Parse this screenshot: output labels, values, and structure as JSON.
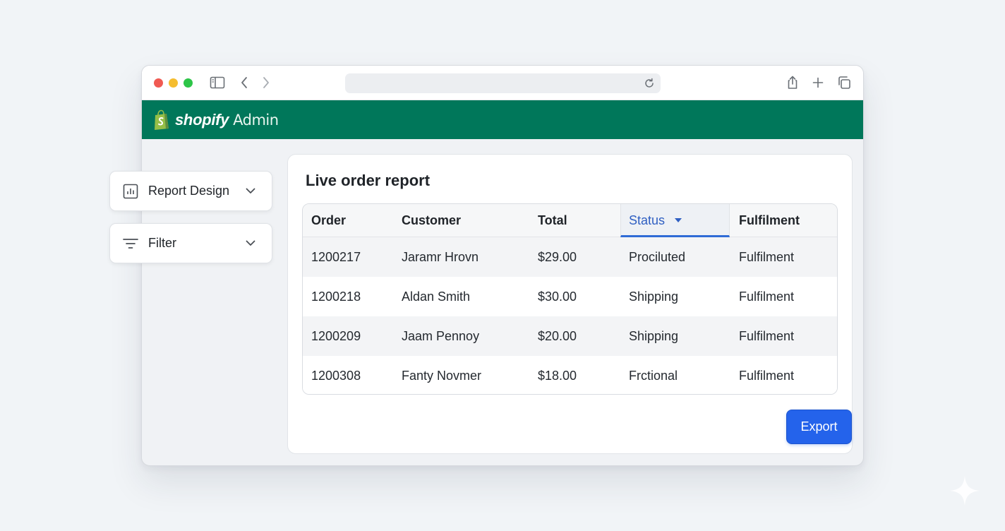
{
  "browser": {
    "url": ""
  },
  "header": {
    "brand": "shopify",
    "brand_suffix": "Admin"
  },
  "sidebar": {
    "items": [
      {
        "label": "Report Design",
        "icon": "bar-chart-icon"
      },
      {
        "label": "Filter",
        "icon": "filter-lines-icon"
      }
    ]
  },
  "report": {
    "title": "Live order report",
    "columns": [
      "Order",
      "Customer",
      "Total",
      "Status",
      "Fulfilment"
    ],
    "sorted_column": "Status",
    "rows": [
      [
        "1200217",
        "Jaramr Hrovn",
        "$29.00",
        "Prociluted",
        "Fulfilment"
      ],
      [
        "1200218",
        "Aldan Smith",
        "$30.00",
        "Shipping",
        "Fulfilment"
      ],
      [
        "1200209",
        "Jaam Pennoy",
        "$20.00",
        "Shipping",
        "Fulfilment"
      ],
      [
        "1200308",
        "Fanty Novmer",
        "$18.00",
        "Frctional",
        "Fulfilment"
      ]
    ]
  },
  "actions": {
    "export_label": "Export"
  },
  "colors": {
    "header_green": "#00775a",
    "accent_blue": "#2463eb",
    "sort_blue": "#2f5fc2"
  }
}
